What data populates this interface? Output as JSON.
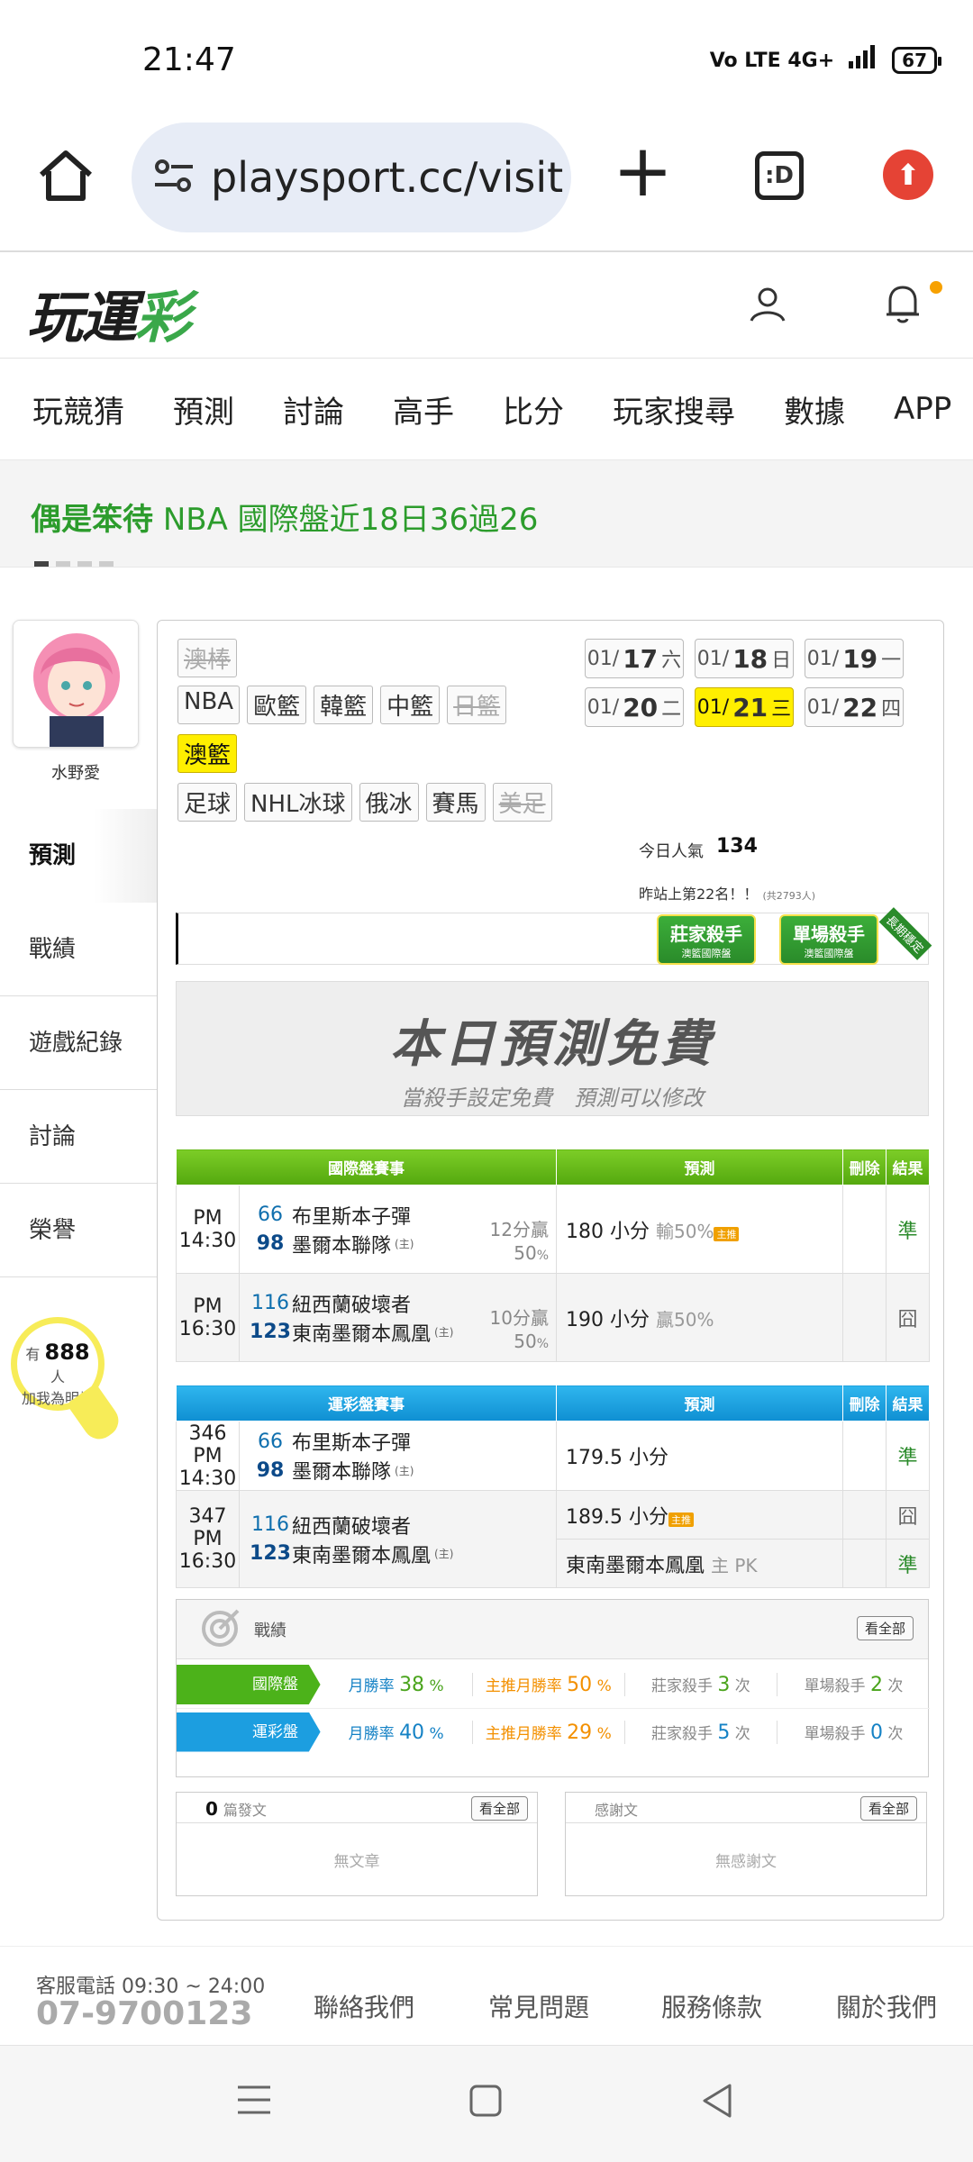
{
  "status": {
    "time": "21:47",
    "network": "Vo LTE 4G+",
    "battery": "67"
  },
  "browser": {
    "url": "playsport.cc/visit",
    "tabs_label": ":D"
  },
  "site": {
    "logo_a": "玩運",
    "logo_b": "彩"
  },
  "nav": [
    "玩競猜",
    "預測",
    "討論",
    "高手",
    "比分",
    "玩家搜尋",
    "數據",
    "APP"
  ],
  "headline": {
    "name": "偶是笨待",
    "text": "NBA 國際盤近18日36過26"
  },
  "profile": {
    "name": "水野愛",
    "fans_prefix": "有",
    "fans_count": "888",
    "fans_unit": "人",
    "fans_cta": "加我為明燈"
  },
  "side_menu": [
    "預測",
    "戰績",
    "遊戲紀錄",
    "討論",
    "榮譽"
  ],
  "sports": {
    "row1": [
      "澳棒"
    ],
    "row2": [
      "NBA",
      "歐籃",
      "韓籃",
      "中籃",
      "日籃"
    ],
    "row3": [
      "澳籃"
    ],
    "row4": [
      "足球",
      "NHL冰球",
      "俄冰",
      "賽馬",
      "美足"
    ]
  },
  "dates": [
    {
      "m": "01/",
      "d": "17",
      "w": "六"
    },
    {
      "m": "01/",
      "d": "18",
      "w": "日"
    },
    {
      "m": "01/",
      "d": "19",
      "w": "一"
    },
    {
      "m": "01/",
      "d": "20",
      "w": "二"
    },
    {
      "m": "01/",
      "d": "21",
      "w": "三"
    },
    {
      "m": "01/",
      "d": "22",
      "w": "四"
    }
  ],
  "popularity": {
    "label": "今日人氣",
    "value": "134",
    "rank": "昨站上第22名！！",
    "rank_note": "(共2793人)"
  },
  "badges": {
    "banker": "莊家殺手",
    "banker_sub": "澳籃國際盤",
    "single": "單場殺手",
    "single_sub": "澳籃國際盤",
    "ribbon": "長期穩定"
  },
  "free": {
    "title": "本日預測免費",
    "subtitle": "當殺手設定免費　預測可以修改"
  },
  "intl_table": {
    "headers": [
      "國際盤賽事",
      "預測",
      "刪除",
      "結果"
    ],
    "rows": [
      {
        "time": "PM 14:30",
        "away_no": "66",
        "away": "布里斯本子彈",
        "home_no": "98",
        "home": "墨爾本聯隊",
        "home_tag": "(主)",
        "stat": "12分贏",
        "pct": "50",
        "pct_unit": "%",
        "pick": "180 小分",
        "pick_sub": "輸50%",
        "res": "準"
      },
      {
        "time": "PM 16:30",
        "away_no": "116",
        "away": "紐西蘭破壞者",
        "home_no": "123",
        "home": "東南墨爾本鳳凰",
        "home_tag": "(主)",
        "stat": "10分贏",
        "pct": "50",
        "pct_unit": "%",
        "pick": "190 小分",
        "pick_sub": "贏50%",
        "res": "囧"
      }
    ]
  },
  "sport_table": {
    "headers": [
      "運彩盤賽事",
      "預測",
      "刪除",
      "結果"
    ],
    "rows": [
      {
        "code": "346",
        "time": "PM 14:30",
        "away_no": "66",
        "away": "布里斯本子彈",
        "home_no": "98",
        "home": "墨爾本聯隊",
        "home_tag": "(主)",
        "pick1": "179.5 小分",
        "res1": "準"
      },
      {
        "code": "347",
        "time": "PM 16:30",
        "away_no": "116",
        "away": "紐西蘭破壞者",
        "home_no": "123",
        "home": "東南墨爾本鳳凰",
        "home_tag": "(主)",
        "pick1": "189.5 小分",
        "res1": "囧",
        "pick2": "東南墨爾本鳳凰",
        "pick2_sub": "主 PK",
        "res2": "準"
      }
    ]
  },
  "record": {
    "title": "戰績",
    "all": "看全部",
    "intl": {
      "label": "國際盤",
      "month_label": "月勝率",
      "month": "38",
      "main_label": "主推月勝率",
      "main": "50",
      "banker_label": "莊家殺手",
      "banker": "3",
      "single_label": "單場殺手",
      "single": "2",
      "pct": "%",
      "times": "次"
    },
    "sport": {
      "label": "運彩盤",
      "month_label": "月勝率",
      "month": "40",
      "main_label": "主推月勝率",
      "main": "29",
      "banker_label": "莊家殺手",
      "banker": "5",
      "single_label": "單場殺手",
      "single": "0",
      "pct": "%",
      "times": "次"
    }
  },
  "posts": {
    "count": "0",
    "label": "篇發文",
    "all": "看全部",
    "empty": "無文章"
  },
  "thanks": {
    "label": "感謝文",
    "all": "看全部",
    "empty": "無感謝文"
  },
  "footer": {
    "phone_label": "客服電話 09:30 ~ 24:00",
    "phone": "07-9700123",
    "links": [
      "聯絡我們",
      "常見問題",
      "服務條款",
      "關於我們"
    ]
  },
  "colors": {
    "brand_green": "#3aa84a",
    "intl_header": "#5fb415",
    "sport_header": "#1c9ee0",
    "selected": "#ffef00"
  }
}
